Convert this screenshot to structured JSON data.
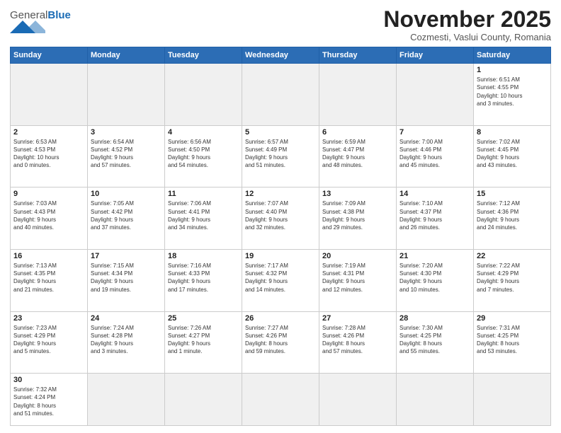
{
  "header": {
    "logo_general": "General",
    "logo_blue": "Blue",
    "month_title": "November 2025",
    "location": "Cozmesti, Vaslui County, Romania"
  },
  "days_of_week": [
    "Sunday",
    "Monday",
    "Tuesday",
    "Wednesday",
    "Thursday",
    "Friday",
    "Saturday"
  ],
  "weeks": [
    [
      {
        "day": "",
        "info": ""
      },
      {
        "day": "",
        "info": ""
      },
      {
        "day": "",
        "info": ""
      },
      {
        "day": "",
        "info": ""
      },
      {
        "day": "",
        "info": ""
      },
      {
        "day": "",
        "info": ""
      },
      {
        "day": "1",
        "info": "Sunrise: 6:51 AM\nSunset: 4:55 PM\nDaylight: 10 hours\nand 3 minutes."
      }
    ],
    [
      {
        "day": "2",
        "info": "Sunrise: 6:53 AM\nSunset: 4:53 PM\nDaylight: 10 hours\nand 0 minutes."
      },
      {
        "day": "3",
        "info": "Sunrise: 6:54 AM\nSunset: 4:52 PM\nDaylight: 9 hours\nand 57 minutes."
      },
      {
        "day": "4",
        "info": "Sunrise: 6:56 AM\nSunset: 4:50 PM\nDaylight: 9 hours\nand 54 minutes."
      },
      {
        "day": "5",
        "info": "Sunrise: 6:57 AM\nSunset: 4:49 PM\nDaylight: 9 hours\nand 51 minutes."
      },
      {
        "day": "6",
        "info": "Sunrise: 6:59 AM\nSunset: 4:47 PM\nDaylight: 9 hours\nand 48 minutes."
      },
      {
        "day": "7",
        "info": "Sunrise: 7:00 AM\nSunset: 4:46 PM\nDaylight: 9 hours\nand 45 minutes."
      },
      {
        "day": "8",
        "info": "Sunrise: 7:02 AM\nSunset: 4:45 PM\nDaylight: 9 hours\nand 43 minutes."
      }
    ],
    [
      {
        "day": "9",
        "info": "Sunrise: 7:03 AM\nSunset: 4:43 PM\nDaylight: 9 hours\nand 40 minutes."
      },
      {
        "day": "10",
        "info": "Sunrise: 7:05 AM\nSunset: 4:42 PM\nDaylight: 9 hours\nand 37 minutes."
      },
      {
        "day": "11",
        "info": "Sunrise: 7:06 AM\nSunset: 4:41 PM\nDaylight: 9 hours\nand 34 minutes."
      },
      {
        "day": "12",
        "info": "Sunrise: 7:07 AM\nSunset: 4:40 PM\nDaylight: 9 hours\nand 32 minutes."
      },
      {
        "day": "13",
        "info": "Sunrise: 7:09 AM\nSunset: 4:38 PM\nDaylight: 9 hours\nand 29 minutes."
      },
      {
        "day": "14",
        "info": "Sunrise: 7:10 AM\nSunset: 4:37 PM\nDaylight: 9 hours\nand 26 minutes."
      },
      {
        "day": "15",
        "info": "Sunrise: 7:12 AM\nSunset: 4:36 PM\nDaylight: 9 hours\nand 24 minutes."
      }
    ],
    [
      {
        "day": "16",
        "info": "Sunrise: 7:13 AM\nSunset: 4:35 PM\nDaylight: 9 hours\nand 21 minutes."
      },
      {
        "day": "17",
        "info": "Sunrise: 7:15 AM\nSunset: 4:34 PM\nDaylight: 9 hours\nand 19 minutes."
      },
      {
        "day": "18",
        "info": "Sunrise: 7:16 AM\nSunset: 4:33 PM\nDaylight: 9 hours\nand 17 minutes."
      },
      {
        "day": "19",
        "info": "Sunrise: 7:17 AM\nSunset: 4:32 PM\nDaylight: 9 hours\nand 14 minutes."
      },
      {
        "day": "20",
        "info": "Sunrise: 7:19 AM\nSunset: 4:31 PM\nDaylight: 9 hours\nand 12 minutes."
      },
      {
        "day": "21",
        "info": "Sunrise: 7:20 AM\nSunset: 4:30 PM\nDaylight: 9 hours\nand 10 minutes."
      },
      {
        "day": "22",
        "info": "Sunrise: 7:22 AM\nSunset: 4:29 PM\nDaylight: 9 hours\nand 7 minutes."
      }
    ],
    [
      {
        "day": "23",
        "info": "Sunrise: 7:23 AM\nSunset: 4:29 PM\nDaylight: 9 hours\nand 5 minutes."
      },
      {
        "day": "24",
        "info": "Sunrise: 7:24 AM\nSunset: 4:28 PM\nDaylight: 9 hours\nand 3 minutes."
      },
      {
        "day": "25",
        "info": "Sunrise: 7:26 AM\nSunset: 4:27 PM\nDaylight: 9 hours\nand 1 minute."
      },
      {
        "day": "26",
        "info": "Sunrise: 7:27 AM\nSunset: 4:26 PM\nDaylight: 8 hours\nand 59 minutes."
      },
      {
        "day": "27",
        "info": "Sunrise: 7:28 AM\nSunset: 4:26 PM\nDaylight: 8 hours\nand 57 minutes."
      },
      {
        "day": "28",
        "info": "Sunrise: 7:30 AM\nSunset: 4:25 PM\nDaylight: 8 hours\nand 55 minutes."
      },
      {
        "day": "29",
        "info": "Sunrise: 7:31 AM\nSunset: 4:25 PM\nDaylight: 8 hours\nand 53 minutes."
      }
    ],
    [
      {
        "day": "30",
        "info": "Sunrise: 7:32 AM\nSunset: 4:24 PM\nDaylight: 8 hours\nand 51 minutes."
      },
      {
        "day": "",
        "info": ""
      },
      {
        "day": "",
        "info": ""
      },
      {
        "day": "",
        "info": ""
      },
      {
        "day": "",
        "info": ""
      },
      {
        "day": "",
        "info": ""
      },
      {
        "day": "",
        "info": ""
      }
    ]
  ]
}
